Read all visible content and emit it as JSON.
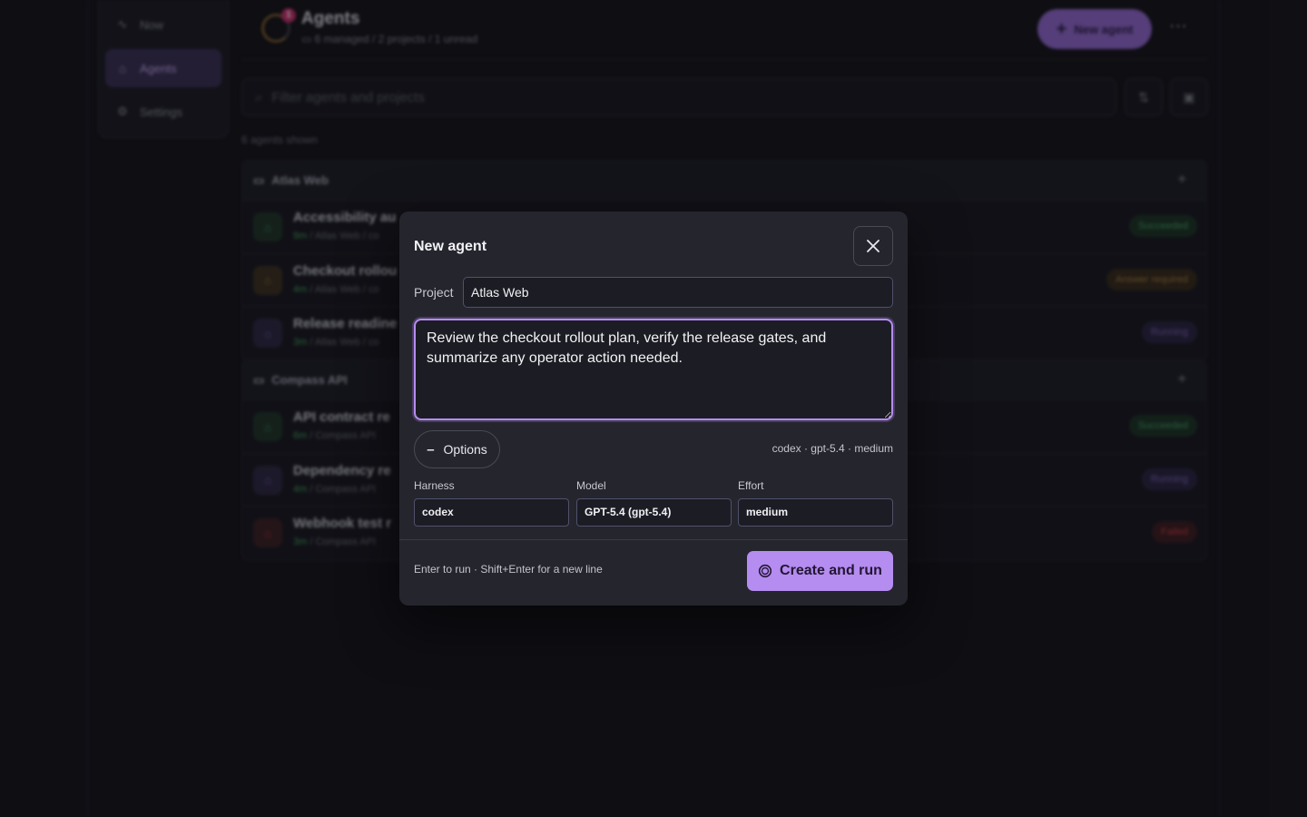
{
  "sidebar": {
    "items": [
      {
        "icon": "activity-icon",
        "label": "Now"
      },
      {
        "icon": "bot-icon",
        "label": "Agents"
      },
      {
        "icon": "gear-icon",
        "label": "Settings"
      }
    ]
  },
  "header": {
    "badge": "1",
    "title": "Agents",
    "subtitle": "6 managed / 2 projects / 1 unread",
    "new_agent_label": "New agent",
    "more_label": "⋯"
  },
  "search": {
    "placeholder": "Filter agents and projects"
  },
  "agents_count": "6 agents shown",
  "groups": [
    {
      "name": "Atlas Web",
      "rows": [
        {
          "title": "Accessibility au",
          "age": "9m",
          "meta": " / Atlas Web / co",
          "status": "Succeeded"
        },
        {
          "title": "Checkout rollou",
          "age": "4m",
          "meta": " / Atlas Web / co",
          "status": "Answer required"
        },
        {
          "title": "Release readine",
          "age": "3m",
          "meta": " / Atlas Web / co",
          "status": "Running"
        }
      ]
    },
    {
      "name": "Compass API",
      "rows": [
        {
          "title": "API contract re",
          "age": "6m",
          "meta": " / Compass API",
          "status": "Succeeded"
        },
        {
          "title": "Dependency re",
          "age": "4m",
          "meta": " / Compass API",
          "status": "Running"
        },
        {
          "title": "Webhook test r",
          "age": "3m",
          "meta": " / Compass API",
          "status": "Failed"
        }
      ]
    }
  ],
  "modal": {
    "title": "New agent",
    "project_label": "Project",
    "project_value": "Atlas Web",
    "prompt": "Review the checkout rollout plan, verify the release gates, and summarize any operator action needed.",
    "options_label": "Options",
    "summary": "codex · gpt-5.4 · medium",
    "harness_label": "Harness",
    "harness_value": "codex",
    "model_label": "Model",
    "model_value": "GPT-5.4 (gpt-5.4)",
    "effort_label": "Effort",
    "effort_value": "medium",
    "hint": "Enter to run · Shift+Enter for a new line",
    "create_label": "Create and run"
  },
  "colors": {
    "accent": "#b58cf0",
    "succeeded": "#3f9b5a",
    "answer_required": "#a07a3c",
    "running": "#7a62b0",
    "failed": "#c0393f"
  }
}
